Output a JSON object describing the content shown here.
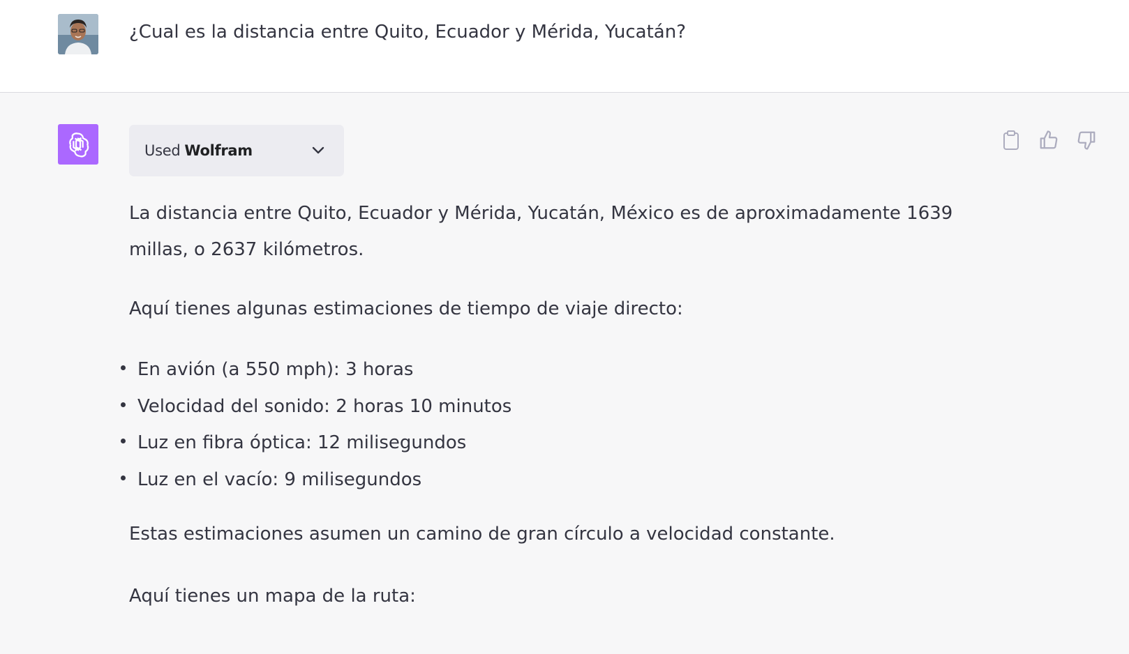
{
  "user_message": {
    "avatar": "user-photo-avatar",
    "text": "¿Cual es la distancia entre Quito, Ecuador y Mérida, Yucatán?"
  },
  "assistant_message": {
    "avatar": "openai-logo-icon",
    "avatar_color": "#ab68ff",
    "plugin": {
      "used_label": "Used",
      "name": "Wolfram",
      "expand_icon": "chevron-down-icon"
    },
    "actions": [
      {
        "icon": "clipboard-icon"
      },
      {
        "icon": "thumbs-up-icon"
      },
      {
        "icon": "thumbs-down-icon"
      }
    ],
    "paragraphs": [
      "La distancia entre Quito, Ecuador y Mérida, Yucatán, México es de aproximadamente 1639 millas, o 2637 kilómetros.",
      "Aquí tienes algunas estimaciones de tiempo de viaje directo:"
    ],
    "bullets": [
      "En avión (a 550 mph): 3 horas",
      "Velocidad del sonido: 2 horas 10 minutos",
      "Luz en fibra óptica: 12 milisegundos",
      "Luz en el vacío: 9 milisegundos"
    ],
    "closing_paragraphs": [
      "Estas estimaciones asumen un camino de gran círculo a velocidad constante.",
      "Aquí tienes un mapa de la ruta:"
    ]
  },
  "colors": {
    "user_row_bg": "#ffffff",
    "assistant_row_bg": "#f7f7f8",
    "text": "#343541",
    "plugin_pill_bg": "#ececf1"
  }
}
